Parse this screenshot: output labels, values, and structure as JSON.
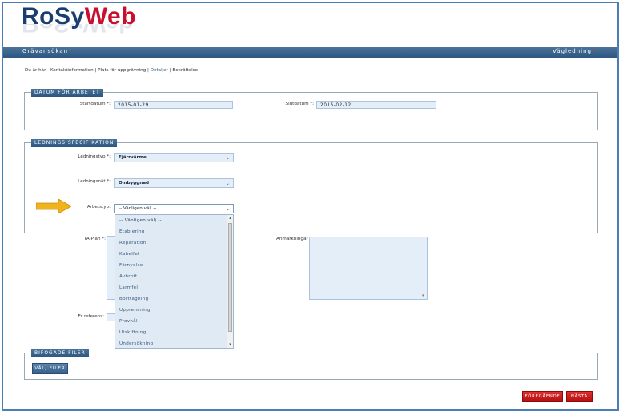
{
  "logo": {
    "part1": "Ro",
    "part2": "Sy",
    "part3": "Web"
  },
  "header": {
    "title": "Grävansökan",
    "right_link": "Vägledning",
    "right_sup": "+"
  },
  "breadcrumb": {
    "prefix": "Du är här - Kontaktinformation | Plats för uppgrävning | ",
    "current": "Detaljer",
    "suffix": " | Bekräftelse"
  },
  "datum": {
    "legend": "DATUM FÖR ARBETET",
    "start_label": "Startdatum *:",
    "start_value": "2015-01-29",
    "end_label": "Slutdatum *:",
    "end_value": "2015-02-12"
  },
  "ledning": {
    "legend": "LEDNINGS SPECIFIKATION",
    "typ_label": "Ledningstyp *:",
    "typ_value": "Fjärrvärme",
    "nat_label": "Ledningsnät *:",
    "nat_value": "Ombyggnad",
    "arbetstyp_label": "Arbetstyp:",
    "arbetstyp_value": "-- Vänligen välj --",
    "options": [
      "-- Vänligen välj --",
      "Etablering",
      "Reparation",
      "Kabelfel",
      "Förnyelse",
      "Avbrott",
      "Larmfel",
      "Borttagning",
      "Upprensning",
      "Provhål",
      "Utskiftning",
      "Undersökning"
    ]
  },
  "taplan_label": "TA-Plan *:",
  "anmarkningar_label": "Anmärkningar",
  "er_referens_label": "Er referens:",
  "files": {
    "legend": "BIFOGADE FILER",
    "button": "VÄLJ FILER"
  },
  "nav": {
    "prev": "FÖREGÅENDE",
    "next": "NÄSTA"
  },
  "colors": {
    "brand_blue": "#2b557f",
    "brand_red": "#c8102e",
    "arrow": "#f2b21c"
  }
}
